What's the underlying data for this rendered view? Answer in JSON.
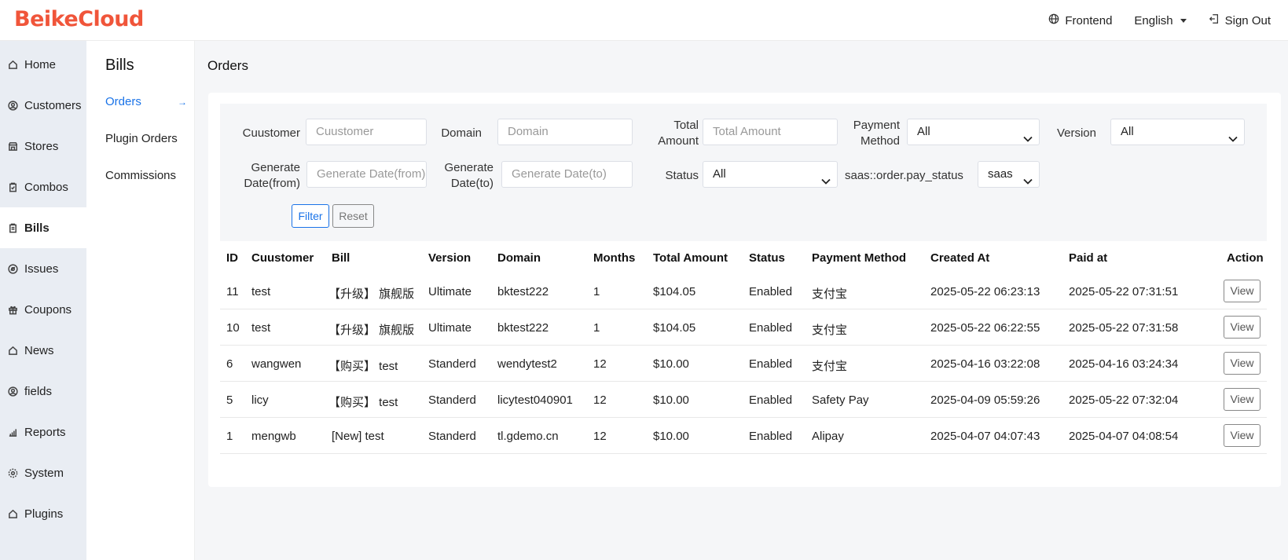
{
  "brand": "BeikeCloud",
  "header": {
    "frontend": "Frontend",
    "language": "English",
    "signout": "Sign Out"
  },
  "sidebar": {
    "items": [
      {
        "label": "Home",
        "icon": "home-icon"
      },
      {
        "label": "Customers",
        "icon": "user-circle-icon"
      },
      {
        "label": "Stores",
        "icon": "store-icon"
      },
      {
        "label": "Combos",
        "icon": "clipboard-icon"
      },
      {
        "label": "Bills",
        "icon": "bill-icon"
      },
      {
        "label": "Issues",
        "icon": "issue-icon"
      },
      {
        "label": "Coupons",
        "icon": "gift-icon"
      },
      {
        "label": "News",
        "icon": "home-icon"
      },
      {
        "label": "fields",
        "icon": "user-circle-icon"
      },
      {
        "label": "Reports",
        "icon": "bar-chart-icon"
      },
      {
        "label": "System",
        "icon": "gear-icon"
      },
      {
        "label": "Plugins",
        "icon": "home-icon"
      }
    ],
    "active": "Bills"
  },
  "subsidebar": {
    "title": "Bills",
    "items": [
      "Orders",
      "Plugin Orders",
      "Commissions"
    ],
    "active": "Orders",
    "active_arrow": "→"
  },
  "page": {
    "title": "Orders"
  },
  "filter": {
    "customer_label": "Cuustomer",
    "customer_placeholder": "Cuustomer",
    "domain_label": "Domain",
    "domain_placeholder": "Domain",
    "total_label_1": "Total",
    "total_label_2": "Amount",
    "total_placeholder": "Total Amount",
    "payment_label_1": "Payment",
    "payment_label_2": "Method",
    "payment_value": "All",
    "version_label": "Version",
    "version_value": "All",
    "gen_from_label_1": "Generate",
    "gen_from_label_2": "Date(from)",
    "gen_from_placeholder": "Generate Date(from)",
    "gen_to_label_1": "Generate",
    "gen_to_label_2": "Date(to)",
    "gen_to_placeholder": "Generate Date(to)",
    "status_label": "Status",
    "status_value": "All",
    "pay_status_label": "saas::order.pay_status",
    "pay_status_value": "saas",
    "filter_button": "Filter",
    "reset_button": "Reset"
  },
  "table": {
    "headers": [
      "ID",
      "Cuustomer",
      "Bill",
      "Version",
      "Domain",
      "Months",
      "Total Amount",
      "Status",
      "Payment Method",
      "Created At",
      "Paid at",
      "Action"
    ],
    "rows": [
      [
        "11",
        "test",
        "【升级】 旗舰版",
        "Ultimate",
        "bktest222",
        "1",
        "$104.05",
        "Enabled",
        "支付宝",
        "2025-05-22 06:23:13",
        "2025-05-22 07:31:51",
        "View"
      ],
      [
        "10",
        "test",
        "【升级】 旗舰版",
        "Ultimate",
        "bktest222",
        "1",
        "$104.05",
        "Enabled",
        "支付宝",
        "2025-05-22 06:22:55",
        "2025-05-22 07:31:58",
        "View"
      ],
      [
        "6",
        "wangwen",
        "【购买】 test",
        "Standerd",
        "wendytest2",
        "12",
        "$10.00",
        "Enabled",
        "支付宝",
        "2025-04-16 03:22:08",
        "2025-04-16 03:24:34",
        "View"
      ],
      [
        "5",
        "licy",
        "【购买】 test",
        "Standerd",
        "licytest040901",
        "12",
        "$10.00",
        "Enabled",
        "Safety Pay",
        "2025-04-09 05:59:26",
        "2025-05-22 07:32:04",
        "View"
      ],
      [
        "1",
        "mengwb",
        "[New] test",
        "Standerd",
        "tl.gdemo.cn",
        "12",
        "$10.00",
        "Enabled",
        "Alipay",
        "2025-04-07 04:07:43",
        "2025-04-07 04:08:54",
        "View"
      ]
    ]
  },
  "colors": {
    "brand": "#f0553a",
    "accent": "#1a73e8"
  }
}
